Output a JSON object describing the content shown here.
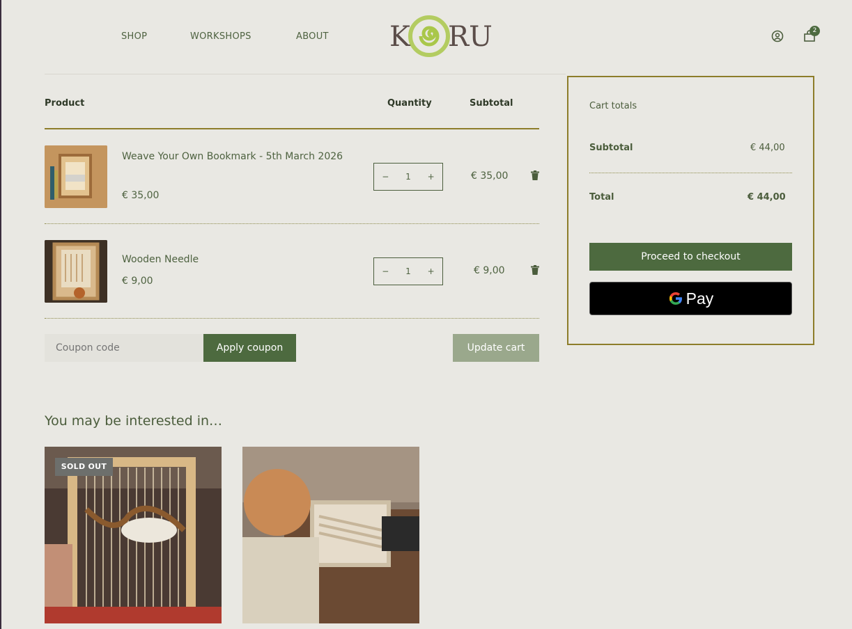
{
  "header": {
    "nav": [
      "SHOP",
      "WORKSHOPS",
      "ABOUT"
    ],
    "logo_letters": [
      "K",
      "RU"
    ],
    "cart_count": "2"
  },
  "cart": {
    "columns": {
      "product": "Product",
      "quantity": "Quantity",
      "subtotal": "Subtotal"
    },
    "items": [
      {
        "name": "Weave Your Own Bookmark - 5th March 2026",
        "price": "€ 35,00",
        "qty": "1",
        "subtotal": "€ 35,00"
      },
      {
        "name": "Wooden Needle",
        "price": "€ 9,00",
        "qty": "1",
        "subtotal": "€ 9,00"
      }
    ],
    "qty_minus": "−",
    "qty_plus": "+",
    "coupon_placeholder": "Coupon code",
    "apply_coupon": "Apply coupon",
    "update_cart": "Update cart"
  },
  "totals": {
    "title": "Cart totals",
    "subtotal_label": "Subtotal",
    "subtotal_value": "€ 44,00",
    "total_label": "Total",
    "total_value": "€ 44,00",
    "checkout": "Proceed to checkout",
    "gpay": "Pay"
  },
  "related": {
    "title": "You may be interested in…",
    "badge": "SOLD OUT"
  },
  "colors": {
    "accent_green": "#4d6a3f",
    "gold_border": "#8d7d2a",
    "background": "#e9e8e3"
  }
}
